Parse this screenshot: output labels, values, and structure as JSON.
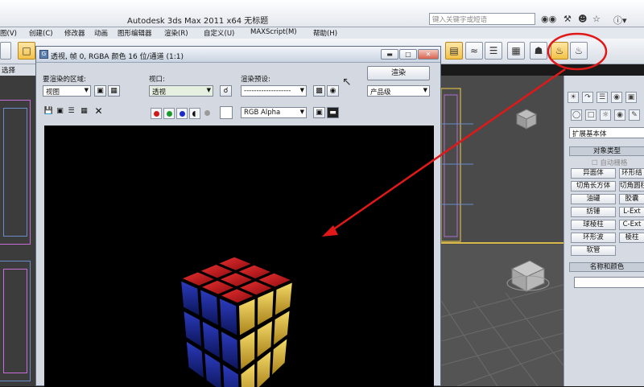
{
  "app": {
    "title": "Autodesk 3ds Max  2011 x64    无标题",
    "search_placeholder": "键入关键字或短语"
  },
  "menu": [
    "图(V)",
    "创建(C)",
    "修改器",
    "动画",
    "图形编辑器",
    "渲染(R)",
    "自定义(U)",
    "MAXScript(M)",
    "帮助(H)"
  ],
  "selection_label": "选择",
  "render_window": {
    "title": "透视, 帧 0, RGBA 颜色 16 位/通道 (1:1)",
    "area_label": "要渲染的区域:",
    "area_value": "视图",
    "viewport_label": "视口:",
    "viewport_value": "透视",
    "preset_label": "渲染预设:",
    "preset_value": "-------------------",
    "render_button": "渲染",
    "quality_value": "产品级",
    "channel_value": "RGB Alpha"
  },
  "command_panel": {
    "category_dropdown": "扩展基本体",
    "object_type_header": "对象类型",
    "autogrid_label": "自动栅格",
    "buttons": [
      "异面体",
      "环形结",
      "切角长方体",
      "切角圆柱体",
      "油罐",
      "胶囊",
      "纺锤",
      "L-Ext",
      "球棱柱",
      "C-Ext",
      "环形波",
      "棱柱",
      "软管"
    ],
    "name_color_header": "名称和颜色"
  },
  "icons": [
    "binoculars-icon",
    "tools-icon",
    "user-icon",
    "star-icon",
    "help-icon",
    "teapot-icon"
  ],
  "colors": {
    "accent": "#f2c246",
    "annotation_red": "#e01818",
    "cube_red": "#c8141a",
    "cube_yellow": "#e8c23a",
    "cube_blue": "#1a2a9a"
  }
}
